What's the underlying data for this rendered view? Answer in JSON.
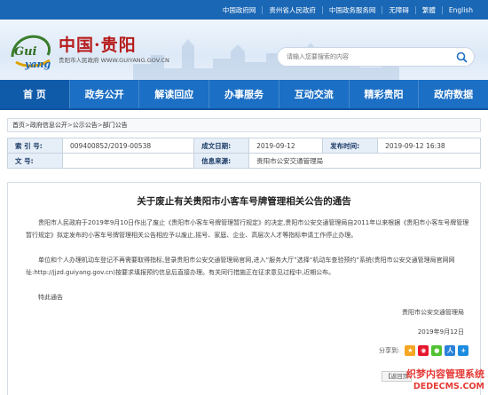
{
  "top_links": [
    "中国政府网",
    "贵州省人民政府",
    "中国政务服务网",
    "无障碍",
    "繁體",
    "English"
  ],
  "header": {
    "logo_text": "Guiyang",
    "site_title": "中国·贵阳",
    "site_subtitle": "贵阳市人民政府 WWW.GUIYANG.GOV.CN",
    "search_placeholder": "请输入您要搜索的内容"
  },
  "nav": [
    "首 页",
    "政务公开",
    "解读回应",
    "办事服务",
    "互动交流",
    "精彩贵阳",
    "政府数据"
  ],
  "breadcrumb": [
    "首页",
    "政府信息公开",
    "公示公告",
    "部门公告"
  ],
  "meta": {
    "index_label": "索 引 号:",
    "index_value": "009400852/2019-00538",
    "date_label": "成文日期:",
    "date_value": "2019-09-12",
    "publish_label": "发布时间:",
    "publish_value": "2019-09-12 16:38",
    "doc_label": "文 号:",
    "doc_value": "",
    "source_label": "信息来源:",
    "source_value": "贵阳市公安交通管理局"
  },
  "article": {
    "title": "关于废止有关贵阳市小客车号牌管理相关公告的通告",
    "para1": "贵阳市人民政府于2019年9月10日作出了废止《贵阳市小客车号牌管理暂行规定》的决定,贵阳市公安交通管理局自2011年以来根据《贵阳市小客车号牌管理暂行规定》拟定发布的小客车号牌管理相关公告相应予以废止,摇号、家庭、企业、高层次人才等指标申请工作停止办理。",
    "para2": "单位和个人办理机动车登记不再需要取得指标,登录贵阳市公安交通管理局官网,进入“服务大厅”选择“机动车查验预约”系统(贵阳市公安交通管理局官网网址:http://jjzd.guiyang.gov.cn)按要求填报预约信息后直接办理。有关同行措施正在征求意见过程中,近期公布。",
    "para3": "特此通告",
    "signature": "贵阳市公安交通管理局",
    "sign_date": "2019年9月12日"
  },
  "share_label": "分享到:",
  "back_label": "【返回顶",
  "watermark": {
    "line1": "织梦内容管理系统",
    "line2": "DEDECMS.COM"
  },
  "colors": {
    "topbar": "#1a67b5",
    "nav": "#1b6fc4",
    "title_red": "#b71c1c",
    "label_bg": "#e6eef7"
  }
}
